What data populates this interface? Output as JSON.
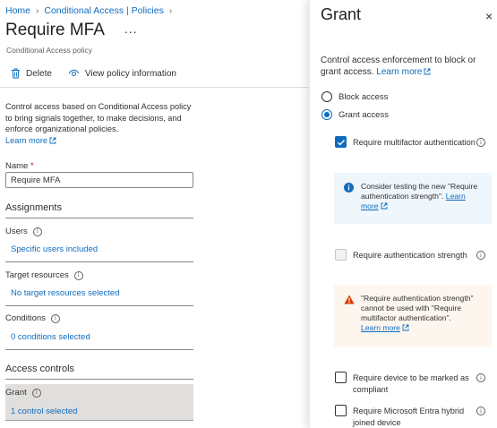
{
  "breadcrumb": {
    "home": "Home",
    "section": "Conditional Access | Policies"
  },
  "page": {
    "title": "Require MFA",
    "more": "...",
    "subtitle": "Conditional Access policy"
  },
  "toolbar": {
    "delete_label": "Delete",
    "view_label": "View policy information"
  },
  "description": {
    "text": "Control access based on Conditional Access policy to bring signals together, to make decisions, and enforce organizational policies.",
    "learn_more": "Learn more"
  },
  "name_field": {
    "label": "Name",
    "required_mark": "*",
    "value": "Require MFA"
  },
  "assignments": {
    "heading": "Assignments",
    "users": {
      "label": "Users",
      "value": "Specific users included"
    },
    "target_resources": {
      "label": "Target resources",
      "value": "No target resources selected"
    },
    "conditions": {
      "label": "Conditions",
      "value": "0 conditions selected"
    }
  },
  "access_controls": {
    "heading": "Access controls",
    "grant": {
      "label": "Grant",
      "value": "1 control selected"
    }
  },
  "panel": {
    "title": "Grant",
    "close": "×",
    "description": "Control access enforcement to block or grant access.",
    "learn_more": "Learn more",
    "radio_block": "Block access",
    "radio_grant": "Grant access",
    "selected_radio": "grant",
    "controls": [
      {
        "label": "Require multifactor authentication",
        "checked": true,
        "disabled": false
      },
      {
        "label": "Require authentication strength",
        "checked": false,
        "disabled": true
      },
      {
        "label": "Require device to be marked as compliant",
        "checked": false,
        "disabled": false
      },
      {
        "label": "Require Microsoft Entra hybrid joined device",
        "checked": false,
        "disabled": false
      }
    ],
    "info_notice": {
      "text": "Consider testing the new \"Require authentication strength\".",
      "link": "Learn more"
    },
    "warn_notice": {
      "text": "\"Require authentication strength\" cannot be used with \"Require multifactor authentication\".",
      "link": "Learn more"
    }
  },
  "colors": {
    "accent": "#0f6cbd",
    "warning": "#d83b01",
    "info_bg": "#eff6fc",
    "warn_bg": "#fdf6ef"
  }
}
